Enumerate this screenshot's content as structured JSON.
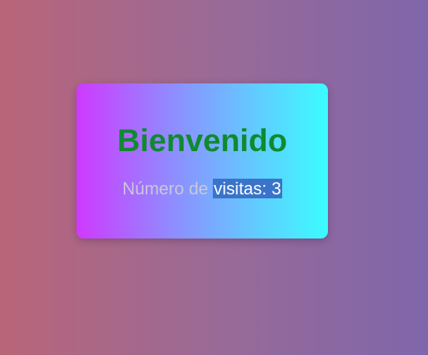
{
  "card": {
    "title": "Bienvenido",
    "visits_prefix": "Número de ",
    "visits_selected": "visitas: 3"
  },
  "colors": {
    "background_left": "#b96579",
    "background_right": "#7f66ab",
    "card_left": "#cf39ff",
    "card_right": "#3bfcff",
    "title": "#0f8a2f",
    "selection_highlight": "#3a74c9"
  }
}
